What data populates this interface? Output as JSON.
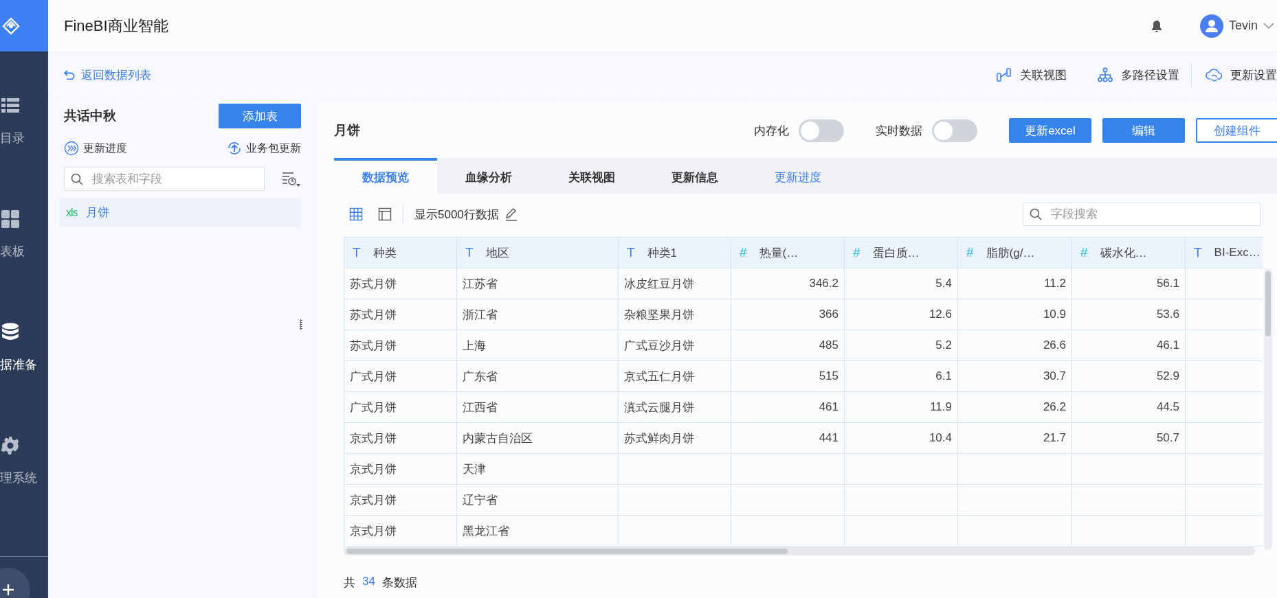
{
  "app": {
    "title": "FineBI商业智能",
    "user": "Tevin"
  },
  "nav": [
    {
      "label": "目录",
      "selected": false
    },
    {
      "label": "表板",
      "selected": false
    },
    {
      "label": "据准备",
      "selected": true
    },
    {
      "label": "理系统",
      "selected": false
    }
  ],
  "back_link": "返回数据列表",
  "actions": [
    {
      "label": "关联视图"
    },
    {
      "label": "多路径设置"
    },
    {
      "label": "更新设置"
    }
  ],
  "package": {
    "title": "共话中秋",
    "add_button": "添加表",
    "progress": "更新进度",
    "update": "业务包更新",
    "search_placeholder": "搜索表和字段",
    "tables": [
      {
        "file_type": "xls",
        "name": "月饼",
        "selected": true
      }
    ]
  },
  "detail": {
    "title": "月饼",
    "toggles": [
      {
        "label": "内存化",
        "on": false
      },
      {
        "label": "实时数据",
        "on": false
      }
    ],
    "buttons": [
      {
        "label": "更新excel",
        "kind": "primary"
      },
      {
        "label": "编辑",
        "kind": "primary"
      },
      {
        "label": "创建组件",
        "kind": "outline"
      }
    ],
    "tabs": [
      {
        "label": "数据预览",
        "selected": true,
        "kind": "tab"
      },
      {
        "label": "血缘分析",
        "selected": false,
        "kind": "tab"
      },
      {
        "label": "关联视图",
        "selected": false,
        "kind": "tab"
      },
      {
        "label": "更新信息",
        "selected": false,
        "kind": "tab"
      },
      {
        "label": "更新进度",
        "selected": false,
        "kind": "link"
      }
    ],
    "row_limit": "显示5000行数据",
    "field_search_placeholder": "字段搜索",
    "table": {
      "columns": [
        {
          "name": "种类",
          "kind": "text",
          "mark": "T"
        },
        {
          "name": "地区",
          "kind": "text",
          "mark": "T"
        },
        {
          "name": "种类1",
          "kind": "text",
          "mark": "T"
        },
        {
          "name": "热量(…",
          "kind": "number",
          "mark": "#"
        },
        {
          "name": "蛋白质…",
          "kind": "number",
          "mark": "#"
        },
        {
          "name": "脂肪(g/…",
          "kind": "number",
          "mark": "#"
        },
        {
          "name": "碳水化…",
          "kind": "number",
          "mark": "#"
        },
        {
          "name": "BI-Exc…",
          "kind": "text",
          "mark": "T"
        }
      ],
      "rows": [
        [
          "苏式月饼",
          "江苏省",
          "冰皮红豆月饼",
          "346.2",
          "5.4",
          "11.2",
          "56.1",
          ""
        ],
        [
          "苏式月饼",
          "浙江省",
          "杂粮坚果月饼",
          "366",
          "12.6",
          "10.9",
          "53.6",
          ""
        ],
        [
          "苏式月饼",
          "上海",
          "广式豆沙月饼",
          "485",
          "5.2",
          "26.6",
          "46.1",
          ""
        ],
        [
          "广式月饼",
          "广东省",
          "京式五仁月饼",
          "515",
          "6.1",
          "30.7",
          "52.9",
          ""
        ],
        [
          "广式月饼",
          "江西省",
          "滇式云腿月饼",
          "461",
          "11.9",
          "26.2",
          "44.5",
          ""
        ],
        [
          "京式月饼",
          "内蒙古自治区",
          "苏式鲜肉月饼",
          "441",
          "10.4",
          "21.7",
          "50.7",
          ""
        ],
        [
          "京式月饼",
          "天津",
          "",
          "",
          "",
          "",
          "",
          ""
        ],
        [
          "京式月饼",
          "辽宁省",
          "",
          "",
          "",
          "",
          "",
          ""
        ],
        [
          "京式月饼",
          "黑龙江省",
          "",
          "",
          "",
          "",
          "",
          ""
        ]
      ]
    },
    "footer": {
      "prefix": "共",
      "count": "34",
      "suffix": "条数据"
    }
  }
}
